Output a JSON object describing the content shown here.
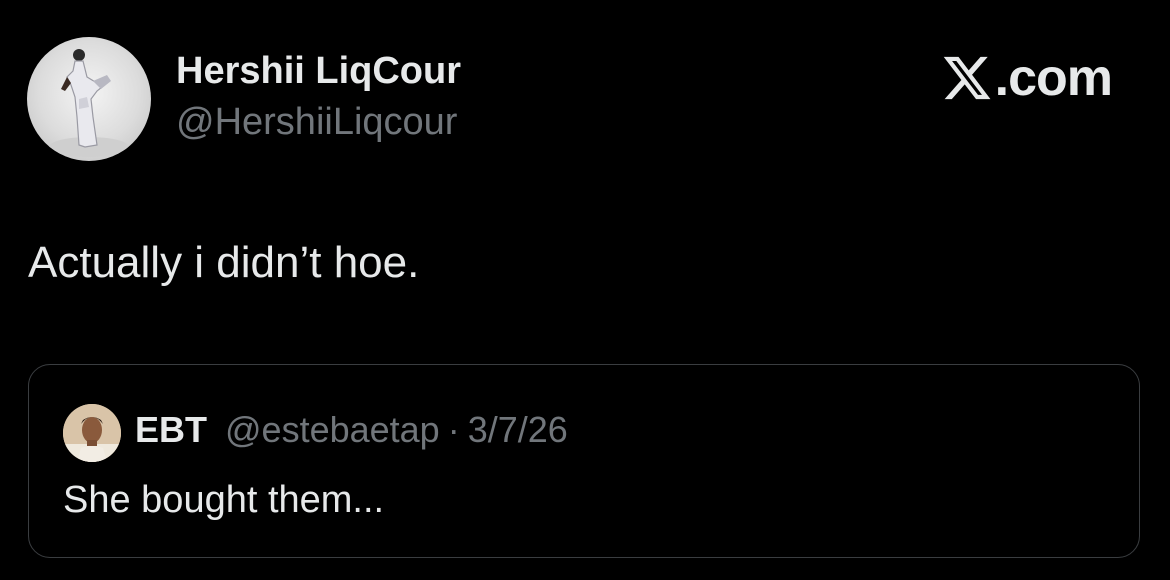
{
  "post": {
    "author": {
      "name": "Hershii LiqCour",
      "handle": "@HershiiLiqcour",
      "avatar_icon": "profile-photo"
    },
    "brand": {
      "icon": "x-logo-icon",
      "text": ".com"
    },
    "text": "Actually i didn’t hoe.",
    "quoted_post": {
      "author": {
        "name": "EBT",
        "handle": "@estebaetap",
        "avatar_icon": "profile-photo"
      },
      "separator": "·",
      "date": "3/7/26",
      "text": "She bought them..."
    }
  },
  "colors": {
    "background": "#000000",
    "primary_text": "#e7e9ea",
    "secondary_text": "#71767b",
    "card_border": "#3a3d40"
  }
}
